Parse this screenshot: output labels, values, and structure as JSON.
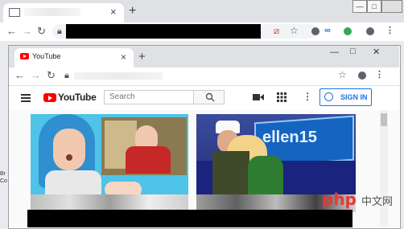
{
  "outer_browser": {
    "tab_close": "×",
    "new_tab": "+",
    "window_buttons": [
      "—",
      "□"
    ],
    "nav": {
      "back": "←",
      "forward": "→",
      "reload": "↻"
    }
  },
  "inner_browser": {
    "tab_title": "YouTube",
    "tab_close": "×",
    "new_tab": "+",
    "window_buttons": [
      "—",
      "□",
      "✕"
    ],
    "nav": {
      "back": "←",
      "forward": "→",
      "reload": "↻"
    }
  },
  "youtube": {
    "logo_text": "YouTube",
    "search_placeholder": "Search",
    "signin_label": "SIGN IN"
  },
  "videos": [
    {
      "overlay_text": ""
    },
    {
      "overlay_text": "ellen15"
    }
  ],
  "left_fragment": "Br\nCo",
  "watermark": {
    "text": "php",
    "cn": "中文网"
  },
  "colors": {
    "youtube_red": "#ff0000",
    "signin_blue": "#1a73e8",
    "redaction": "#000000"
  }
}
